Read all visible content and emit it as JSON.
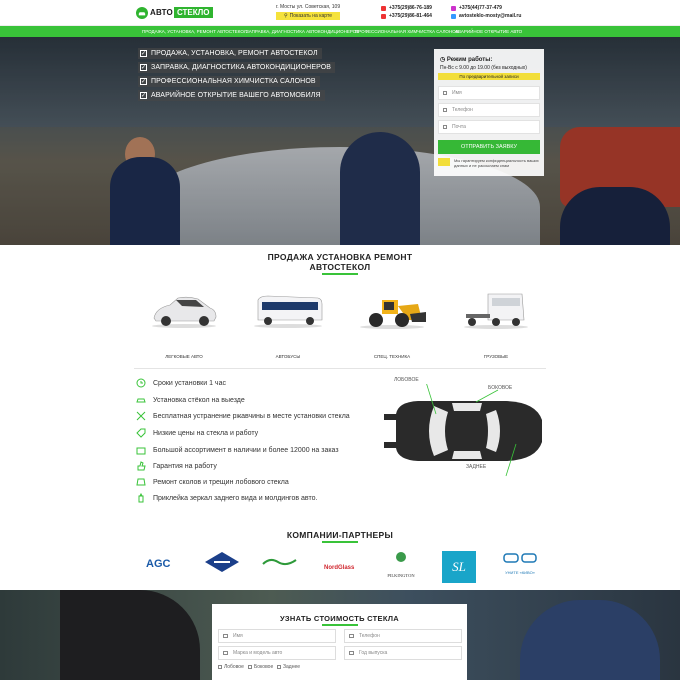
{
  "header": {
    "logo_main": "АВТО",
    "logo_accent": "СТЕКЛО",
    "address": "г. Мосты ул. Советская, 109",
    "map_button": "Показать на карте",
    "phone_1": "+375(29)86-76-189",
    "phone_2": "+375(29)86-81-464",
    "phone_3": "+375(44)77-37-479",
    "email": "avtosteklo-mosty@mail.ru"
  },
  "nav": {
    "items": [
      "ПРОДАЖА, УСТАНОВКА, РЕМОНТ АВТОСТЕКОЛ",
      "ЗАПРАВКА, ДИАГНОСТИКА АВТОКОНДИЦИОНЕРОВ",
      "ПРОФЕССИОНАЛЬНАЯ ХИМЧИСТКА САЛОНОВ",
      "АВАРИЙНОЕ ОТКРЫТИЕ АВТО"
    ]
  },
  "hero": {
    "bullets": [
      "ПРОДАЖА, УСТАНОВКА, РЕМОНТ АВТОСТЕКОЛ",
      "ЗАПРАВКА, ДИАГНОСТИКА АВТОКОНДИЦИОНЕРОВ",
      "ПРОФЕССИОНАЛЬНАЯ ХИМЧИСТКА САЛОНОВ",
      "АВАРИЙНОЕ ОТКРЫТИЕ ВАШЕГО АВТОМОБИЛЯ"
    ]
  },
  "form": {
    "title": "Режим работы:",
    "hours": "Пн-Вс с 9.00 до 19.00 (без выходных)",
    "pre_note": "По предварительной записи",
    "name_placeholder": "Имя",
    "phone_placeholder": "Телефон",
    "email_placeholder": "Почта",
    "submit": "ОТПРАВИТЬ ЗАЯВКУ",
    "privacy": "Мы гарантируем конфиденциальность ваших данных и не рассылаем спам"
  },
  "section1": {
    "title_line1": "ПРОДАЖА УСТАНОВКА РЕМОНТ",
    "title_line2": "АВТОСТЕКОЛ",
    "vehicles": [
      "ЛЕГКОВЫЕ АВТО",
      "АВТОБУСЫ",
      "СПЕЦ. ТЕХНИКА",
      "ГРУЗОВЫЕ"
    ],
    "features": [
      "Сроки установки 1 час",
      "Установка стёкол на выезде",
      "Бесплатная устранение ржавчины в месте установки стекла",
      "Низкие цены на стекла и работу",
      "Большой ассортимент в наличии и более 12000 на заказ",
      "Гарантия на работу",
      "Ремонт сколов и трещин лобового стекла",
      "Приклейка зеркал заднего вида и молдингов авто."
    ],
    "callouts": {
      "front": "ЛОБОВОЕ",
      "side": "БОКОВОЕ",
      "rear": "ЗАДНЕЕ"
    }
  },
  "partners": {
    "title": "КОМПАНИИ-ПАРТНЕРЫ",
    "logos": [
      "AGC",
      "NordGlass",
      "PILKINGTON",
      "SL",
      "УНИТЕ «КИВО»"
    ]
  },
  "quote": {
    "title": "УЗНАТЬ СТОИМОСТЬ СТЕКЛА",
    "name_placeholder": "Имя",
    "phone_placeholder": "Телефон",
    "model_placeholder": "Марка и модель авто",
    "year_placeholder": "Год выпуска",
    "options": [
      "Лобовое",
      "Боковое",
      "Заднее"
    ]
  },
  "colors": {
    "accent": "#39c339",
    "yellow": "#f2de3a"
  }
}
